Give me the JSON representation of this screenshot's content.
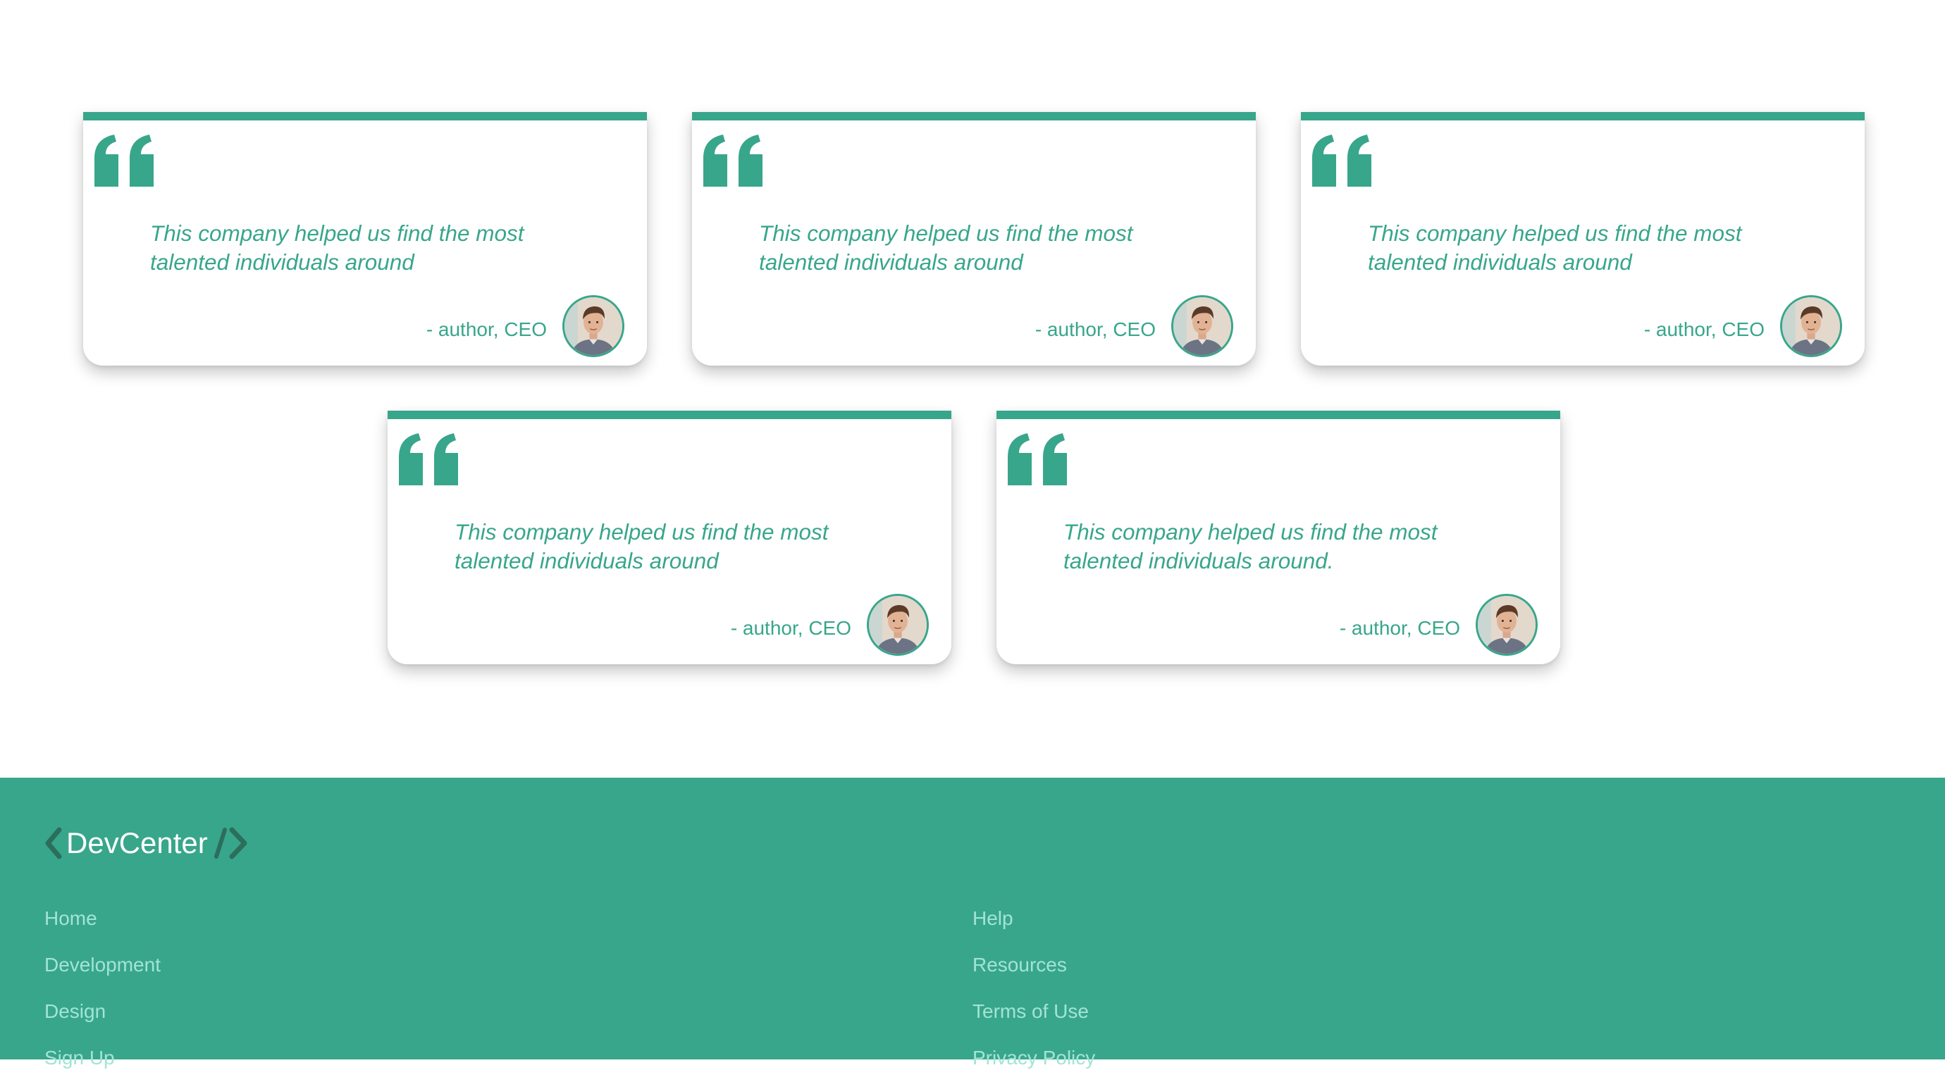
{
  "testimonials": [
    {
      "quote": "This company helped us find the most talented individuals around",
      "author": "- author, CEO"
    },
    {
      "quote": "This company helped us find the most talented individuals around",
      "author": "- author, CEO"
    },
    {
      "quote": "This company helped us find the most talented individuals around",
      "author": "- author, CEO"
    },
    {
      "quote": "This company helped us find the most talented individuals around",
      "author": "- author, CEO"
    },
    {
      "quote": "This company helped us find the most talented individuals around.",
      "author": "- author, CEO"
    }
  ],
  "footer": {
    "brand": "DevCenter",
    "links_left": [
      "Home",
      "Development",
      "Design",
      "Sign Up"
    ],
    "links_right": [
      "Help",
      "Resources",
      "Terms of Use",
      "Privacy Policy"
    ]
  },
  "colors": {
    "accent": "#38a68b",
    "footer_link": "#a3e4d4",
    "brand_bracket": "#2b6e5c"
  },
  "icons": {
    "quote": "left-double-quote-icon",
    "brand_left": "chevron-left-icon",
    "brand_right": "slash-chevron-right-icon"
  }
}
